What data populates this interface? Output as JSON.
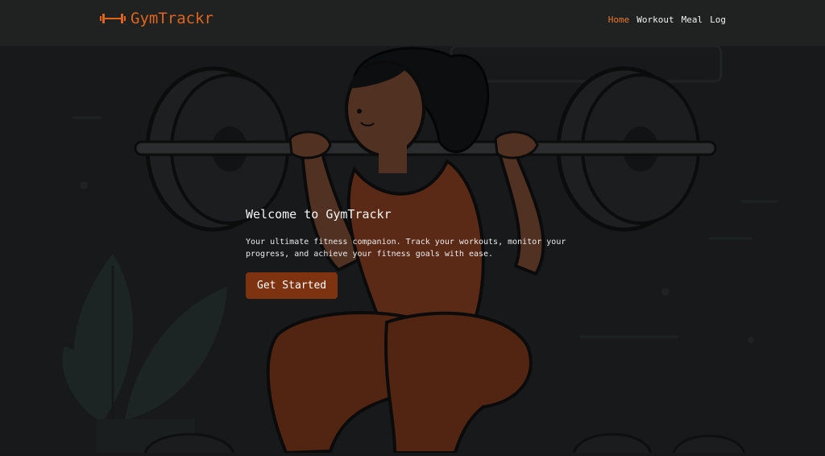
{
  "brand": {
    "name": "GymTrackr",
    "icon": "dumbbell-icon",
    "color": "#e0651b"
  },
  "nav": {
    "items": [
      {
        "label": "Home",
        "active": true
      },
      {
        "label": "Workout",
        "active": false
      },
      {
        "label": "Meal",
        "active": false
      },
      {
        "label": "Log",
        "active": false
      }
    ]
  },
  "hero": {
    "title": "Welcome to GymTrackr",
    "text": "Your ultimate fitness companion. Track your workouts, monitor your progress, and achieve your fitness goals with ease.",
    "cta_label": "Get Started",
    "background_art": "woman-squatting-barbell-illustration"
  },
  "colors": {
    "accent": "#e8772a",
    "button": "#7e3310",
    "navbar": "#202121",
    "background": "#161819"
  }
}
